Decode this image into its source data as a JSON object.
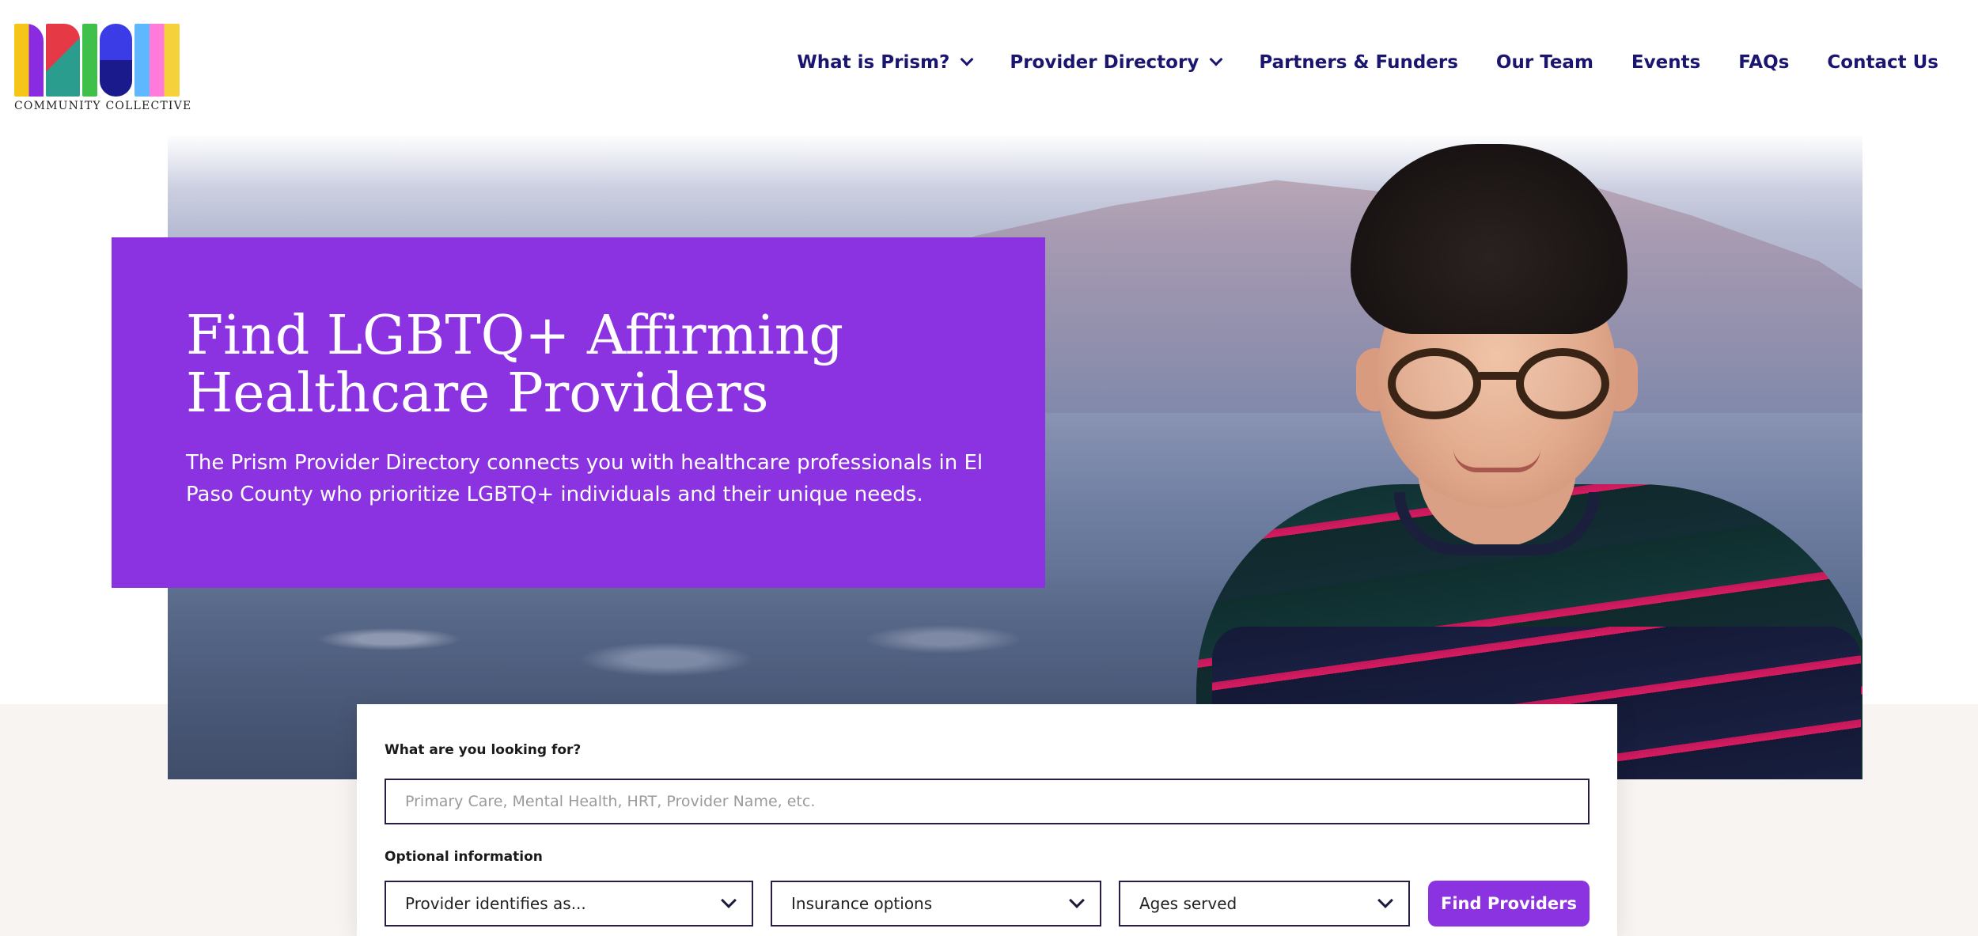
{
  "brand": {
    "logo_text": "PRISM",
    "tagline": "COMMUNITY COLLECTIVE"
  },
  "nav": {
    "items": [
      {
        "label": "What is Prism?",
        "has_dropdown": true
      },
      {
        "label": "Provider Directory",
        "has_dropdown": true
      },
      {
        "label": "Partners & Funders",
        "has_dropdown": false
      },
      {
        "label": "Our Team",
        "has_dropdown": false
      },
      {
        "label": "Events",
        "has_dropdown": false
      },
      {
        "label": "FAQs",
        "has_dropdown": false
      },
      {
        "label": "Contact Us",
        "has_dropdown": false
      }
    ]
  },
  "hero": {
    "title_line1": "Find LGBTQ+ Affirming",
    "title_line2": "Healthcare Providers",
    "description": "The Prism Provider Directory connects you with healthcare professionals in El Paso County who prioritize LGBTQ+ individuals and their unique needs."
  },
  "search": {
    "query_label": "What are you looking for?",
    "query_placeholder": "Primary Care, Mental Health, HRT, Provider Name, etc.",
    "query_value": "",
    "optional_label": "Optional information",
    "filters": [
      {
        "label": "Provider identifies as..."
      },
      {
        "label": "Insurance options"
      },
      {
        "label": "Ages served"
      }
    ],
    "submit_label": "Find Providers"
  },
  "colors": {
    "brand_purple": "#8b33e0",
    "nav_navy": "#1a1670",
    "band_beige": "#f7f4f1"
  }
}
